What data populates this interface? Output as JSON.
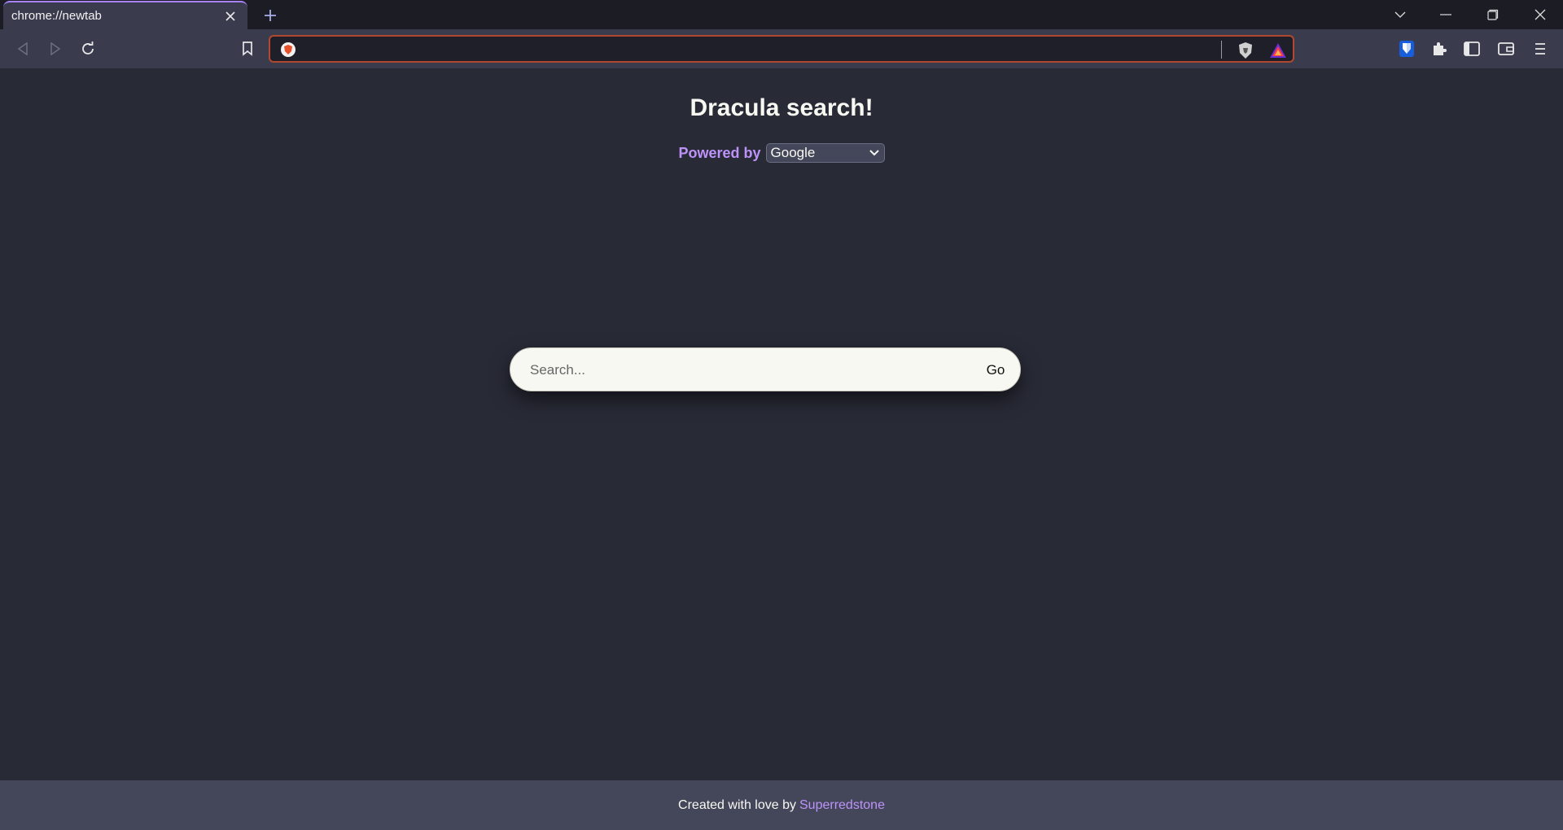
{
  "browser": {
    "tab_title": "chrome://newtab",
    "address_value": "",
    "accent_color": "#a982ff",
    "icons": [
      "close-icon",
      "plus-icon",
      "chevron-down-icon",
      "minimize-icon",
      "restore-icon",
      "back-icon",
      "forward-icon",
      "reload-icon",
      "bookmark-icon",
      "brave-shield-icon",
      "rewards-icon",
      "bitwarden-icon",
      "extensions-icon",
      "sidebar-icon",
      "wallet-icon",
      "menu-icon"
    ]
  },
  "page": {
    "title": "Dracula search!",
    "powered_by_label": "Powered by",
    "engine_selected": "Google",
    "search_placeholder": "Search...",
    "go_label": "Go",
    "colors": {
      "background": "#282a36",
      "purple": "#bd93f9",
      "footer": "#44475a",
      "foreground": "#f8f8f2"
    }
  },
  "footer": {
    "text": "Created with love by",
    "link_text": "Superredstone"
  }
}
